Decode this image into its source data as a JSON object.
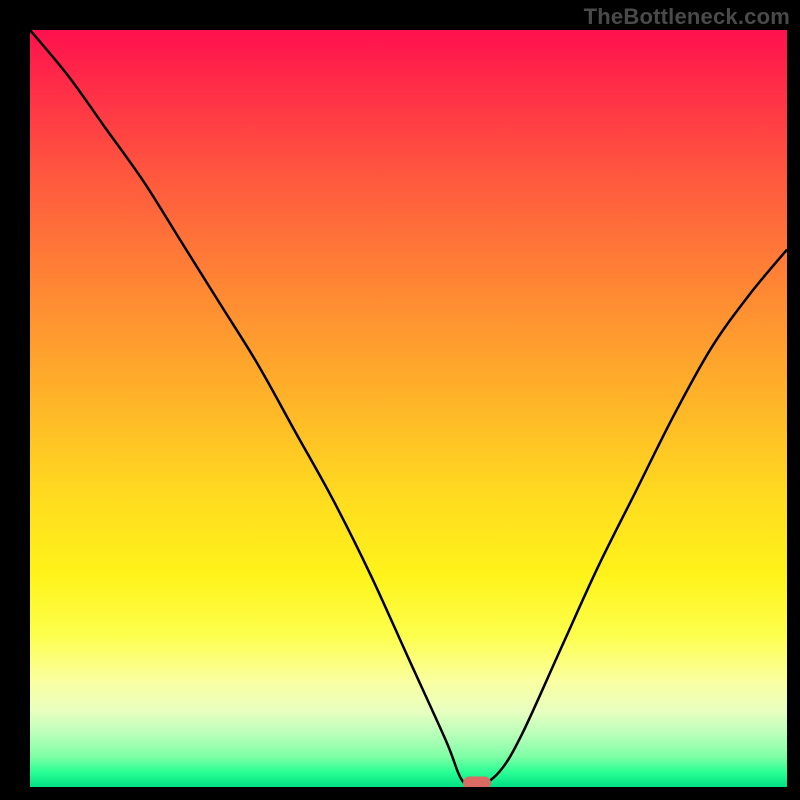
{
  "watermark": "TheBottleneck.com",
  "colors": {
    "frame": "#000000",
    "curve": "#000000",
    "marker": "#d96d64"
  },
  "chart_data": {
    "type": "line",
    "title": "",
    "xlabel": "",
    "ylabel": "",
    "xlim": [
      0,
      100
    ],
    "ylim": [
      0,
      100
    ],
    "grid": false,
    "series": [
      {
        "name": "bottleneck-curve",
        "x": [
          0,
          5,
          10,
          15,
          20,
          25,
          30,
          35,
          40,
          45,
          50,
          55,
          57,
          59,
          62,
          65,
          70,
          75,
          80,
          85,
          90,
          95,
          100
        ],
        "values": [
          100,
          94,
          87,
          80,
          72,
          64,
          56,
          47,
          38,
          28,
          17,
          6,
          1,
          0,
          2,
          7,
          18,
          29,
          39,
          49,
          58,
          65,
          71
        ]
      }
    ],
    "marker": {
      "x": 59,
      "y": 0
    },
    "gradient_stops": [
      {
        "pos": 0,
        "color": "#ff114e"
      },
      {
        "pos": 8,
        "color": "#ff2f47"
      },
      {
        "pos": 20,
        "color": "#ff5a3e"
      },
      {
        "pos": 35,
        "color": "#ff8a33"
      },
      {
        "pos": 50,
        "color": "#ffb728"
      },
      {
        "pos": 62,
        "color": "#ffdc1f"
      },
      {
        "pos": 72,
        "color": "#fff31a"
      },
      {
        "pos": 80,
        "color": "#fdff4d"
      },
      {
        "pos": 86,
        "color": "#faffa0"
      },
      {
        "pos": 90,
        "color": "#e8ffc0"
      },
      {
        "pos": 93,
        "color": "#b9ffba"
      },
      {
        "pos": 96,
        "color": "#7effa5"
      },
      {
        "pos": 98,
        "color": "#2bff95"
      },
      {
        "pos": 100,
        "color": "#00e083"
      }
    ]
  }
}
